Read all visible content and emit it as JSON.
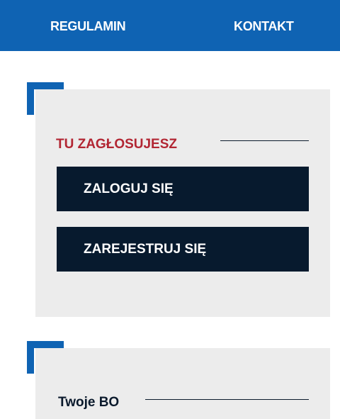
{
  "nav": {
    "regulamin": "REGULAMIN",
    "kontakt": "KONTAKT"
  },
  "vote_panel": {
    "title": "TU ZAGŁOSUJESZ",
    "login_label": "ZALOGUJ SIĘ",
    "register_label": "ZAREJESTRUJ SIĘ"
  },
  "bo_panel": {
    "title": "Twoje BO"
  },
  "colors": {
    "brand_blue": "#0f63b3",
    "accent_red": "#b22633",
    "button_navy": "#071a2e",
    "panel_gray": "#ececec"
  }
}
